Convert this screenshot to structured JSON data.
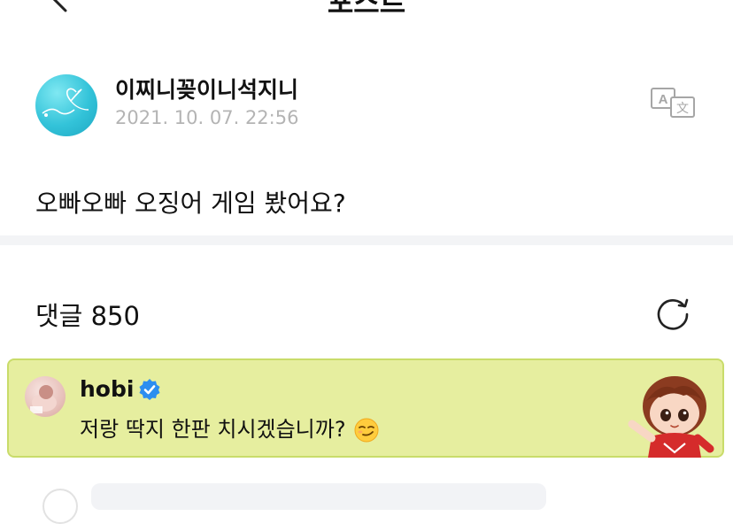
{
  "nav": {
    "title": "포스트",
    "more": "···"
  },
  "post": {
    "author": "이찌니꽂이니석지니",
    "date": "2021. 10. 07. 22:56",
    "body": "오빠오빠 오징어 게임 봤어요?"
  },
  "comments": {
    "header": "댓글 850"
  },
  "pinned_comment": {
    "name": "hobi",
    "text": "저랑 딱지 한판 치시겠습니까?",
    "accent": "#e6ee9f"
  },
  "icons": {
    "back": "chevron-left-icon",
    "translate": "translate-icon",
    "refresh": "refresh-icon",
    "verified": "verified-badge-icon",
    "emoji": "smirk-emoji-icon"
  }
}
